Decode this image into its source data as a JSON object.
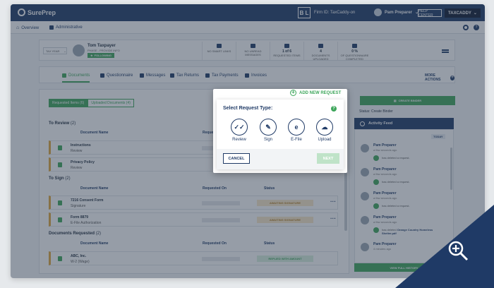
{
  "topbar": {
    "logo": "SurePrep",
    "firm_badge": "B L",
    "firm_id": "Firm ID: TaxCaddy-on",
    "user_name": "Pam Preparer",
    "help_center": "HELP CENTER",
    "taxcaddy": "TAXCADDY"
  },
  "subnav": {
    "overview": "Overview",
    "administrative": "Administrative"
  },
  "client": {
    "tax_year": "TAX YEAR",
    "name": "Tom Taxpayer",
    "subtitle": "PHASE - PROVIDE INFO",
    "following": "FOLLOWING",
    "stats": [
      {
        "value": "",
        "label": "NO SMART LINKS"
      },
      {
        "value": "",
        "label": "NO UNREAD MESSAGES"
      },
      {
        "value": "1 of 6",
        "label": "REQUESTED ITEMS"
      },
      {
        "value": "4",
        "label": "DOCUMENTS UPLOADED"
      },
      {
        "value": "0 %",
        "label": "OF QUESTIONNAIRE COMPLETED"
      }
    ]
  },
  "tabs": {
    "documents": "Documents",
    "questionnaire": "Questionnaire",
    "messages": "Messages",
    "tax_returns": "Tax Returns",
    "tax_payments": "Tax Payments",
    "invoices": "Invoices",
    "more_actions": "MORE ACTIONS"
  },
  "main": {
    "requested_items": "Requested Items (6)",
    "uploaded_documents": "Uploaded Documents (4)",
    "to_review_title": "To Review",
    "to_review_count": "(2)",
    "to_sign_title": "To Sign",
    "to_sign_count": "(2)",
    "docs_requested_title": "Documents Requested",
    "docs_requested_count": "(2)",
    "col_document_name": "Document Name",
    "col_requested_on": "Requested On",
    "col_status": "Status",
    "review_rows": [
      {
        "name": "Instructions",
        "sub": "Review"
      },
      {
        "name": "Privacy Policy",
        "sub": "Review"
      }
    ],
    "sign_rows": [
      {
        "name": "7216 Consent Form",
        "sub": "Signature",
        "status": "AWAITING SIGNATURE"
      },
      {
        "name": "Form 8879",
        "sub": "E-File Authorization",
        "status": "AWAITING SIGNATURE"
      }
    ],
    "requested_rows": [
      {
        "name": "ABC, Inc.",
        "sub": "W-2 (Wage)",
        "status": "REPLIED WITH AMOUNT"
      }
    ]
  },
  "right": {
    "create_binder": "CREATE BINDER",
    "status": "Status: Create Binder",
    "activity_feed": "Activity Feed",
    "today": "TODAY",
    "feed": [
      {
        "name": "Pam Preparer",
        "time": "a few seconds ago",
        "desc_pre": "has deleted a request.",
        "desc_bold": ""
      },
      {
        "name": "Pam Preparer",
        "time": "a few seconds ago",
        "desc_pre": "has deleted a request.",
        "desc_bold": ""
      },
      {
        "name": "Pam Preparer",
        "time": "a few seconds ago",
        "desc_pre": "has deleted a request.",
        "desc_bold": ""
      },
      {
        "name": "Pam Preparer",
        "time": "a few seconds ago",
        "desc_pre": "has deleted",
        "desc_bold": "Orange Country Homeless Shelter.pdf"
      },
      {
        "name": "Pam Preparer",
        "time": "4 minutes ago",
        "desc_pre": "",
        "desc_bold": ""
      }
    ],
    "view_full": "VIEW FULL HISTORY"
  },
  "popup": {
    "add_new_request": "ADD NEW REQUEST",
    "title": "Select Request Type:",
    "help": "?",
    "options": [
      {
        "label": "Review",
        "glyph": "✓✓"
      },
      {
        "label": "Sign",
        "glyph": "✎"
      },
      {
        "label": "E-File",
        "glyph": "e"
      },
      {
        "label": "Upload",
        "glyph": "☁"
      }
    ],
    "cancel": "CANCEL",
    "next": "NEXT"
  },
  "colors": {
    "navy": "#1f3a66",
    "green": "#3ea65b",
    "amber": "#e0a63a"
  }
}
